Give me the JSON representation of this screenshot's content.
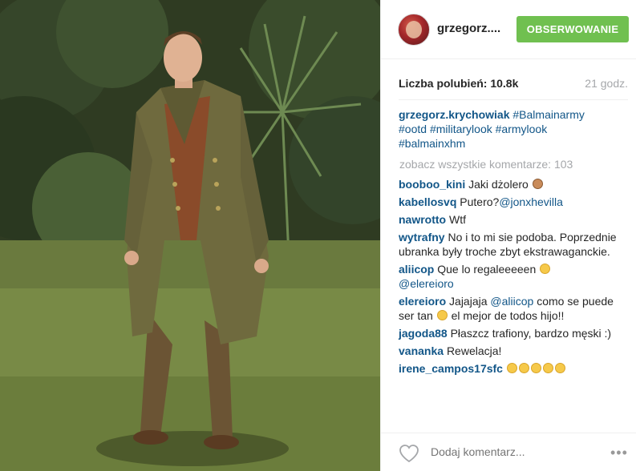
{
  "post": {
    "photo_description_icon": "photo",
    "header": {
      "username": "grzegorz....",
      "follow_label": "OBSERWOWANIE"
    },
    "likes_label": "Liczba polubień: 10.8k",
    "time_label": "21 godz.",
    "caption": {
      "user": "grzegorz.krychowiak",
      "tag1": "#Balmainarmy",
      "tag2": "#ootd",
      "tag3": "#militarylook",
      "tag4": "#armylook",
      "tag5": "#balmainxhm"
    },
    "view_all": "zobacz wszystkie komentarze: 103",
    "comments": [
      {
        "user": "booboo_kini",
        "text": "Jaki dżolero",
        "emoji": "monkey"
      },
      {
        "user": "kabellosvq",
        "text": "Putero?",
        "mention": "@jonxhevilla"
      },
      {
        "user": "nawrotto",
        "text": "Wtf"
      },
      {
        "user": "wytrafny",
        "text": "No i to mi sie podoba. Poprzednie ubranka były troche zbyt ekstrawaganckie."
      },
      {
        "user": "aliicop",
        "text": "Que lo regaleeeeen",
        "mention": "@elereioro"
      },
      {
        "user": "elereioro",
        "text1": "Jajajaja",
        "mention": "@aliicop",
        "text2": "como se puede ser tan",
        "text3": "el mejor de todos hijo!!"
      },
      {
        "user": "jagoda88",
        "text": "Płaszcz trafiony, bardzo męski :)"
      },
      {
        "user": "vananka",
        "text": "Rewelacja!"
      },
      {
        "user": "irene_campos17sfc",
        "text": ""
      }
    ],
    "footer": {
      "add_comment_placeholder": "Dodaj komentarz...",
      "more_label": "•••"
    }
  },
  "colors": {
    "link_blue": "#125688",
    "follow_green": "#70c050",
    "muted_gray": "#a5a7aa"
  }
}
